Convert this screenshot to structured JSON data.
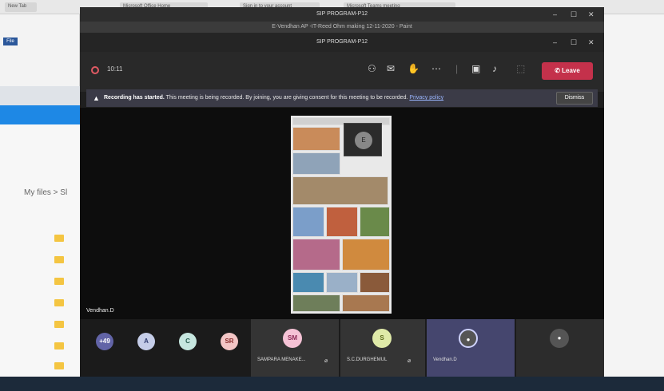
{
  "browser": {
    "tabs": [
      "New Tab",
      "Microsoft Office Home",
      "Sign in to your account",
      "Microsoft Teams meeting"
    ]
  },
  "word": {
    "file_label": "File"
  },
  "explorer": {
    "breadcrumb": "My files > Sl"
  },
  "teams": {
    "outer_title": "SIP PROGRAM-P12",
    "doc_title": "E-Vendhan AP -IT-Reed Ohm making 12-11-2020 - Paint",
    "inner_title": "SIP PROGRAM-P12",
    "timer": "10:11",
    "leave_label": "Leave",
    "banner": {
      "headline": "Recording has started.",
      "message": " This meeting is being recorded. By joining, you are giving consent for this meeting to be recorded.",
      "policy_link": "Privacy policy",
      "dismiss_label": "Dismiss"
    },
    "presenter_name": "Vendhan.D",
    "self_initial": "E",
    "participants_more": "+49",
    "avatars": [
      {
        "initial": "A",
        "color": "#c5cde8",
        "text": "#2d3a6e"
      },
      {
        "initial": "C",
        "color": "#c6e6df",
        "text": "#23584c"
      },
      {
        "initial": "SR",
        "color": "#f3c6c6",
        "text": "#8a2d2d"
      }
    ],
    "participants": [
      {
        "initials": "SM",
        "name": "SAMPARA MENAKE...",
        "color": "#f5c2d5",
        "text": "#8c2855"
      },
      {
        "initials": "S",
        "name": "S.C.DURGHEMUL",
        "color": "#dfeaa8",
        "text": "#5c6a1c"
      },
      {
        "name": "Vendhan.D"
      },
      {
        "name": ""
      }
    ],
    "colors": {
      "leave": "#c4314b",
      "accent": "#6264a7"
    }
  }
}
